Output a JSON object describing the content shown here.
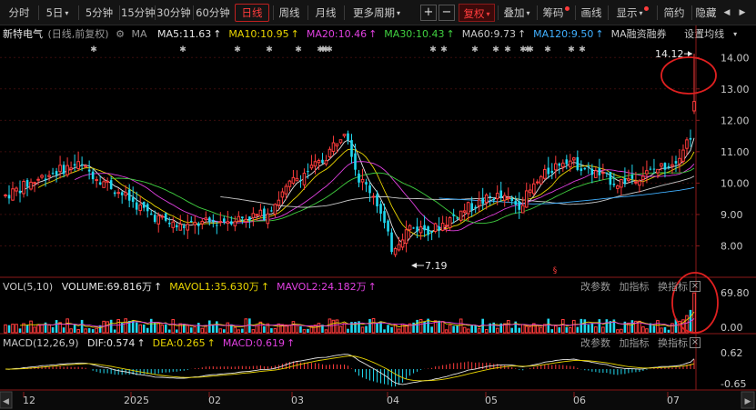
{
  "toolbar": {
    "periods": [
      "分时",
      "5日",
      "5分钟",
      "15分钟",
      "30分钟",
      "60分钟",
      "日线",
      "周线",
      "月线",
      "更多周期"
    ],
    "active_period": "日线",
    "plus": "+",
    "minus": "−",
    "fuquan": "复权",
    "diejia": "叠加",
    "chouma": "筹码",
    "huaxian": "画线",
    "xianshi": "显示",
    "jianyue": "简约",
    "yincang": "隐藏"
  },
  "stock": {
    "name": "新特电气",
    "mode": "(日线,前复权)"
  },
  "ma": {
    "label": "MA",
    "items": [
      {
        "text": "MA5:11.63",
        "color": "#e6e6e6"
      },
      {
        "text": "MA10:10.95",
        "color": "#e8d400"
      },
      {
        "text": "MA20:10.46",
        "color": "#e040e0"
      },
      {
        "text": "MA30:10.43",
        "color": "#40d040"
      },
      {
        "text": "MA60:9.73",
        "color": "#c8c8c8"
      },
      {
        "text": "MA120:9.50",
        "color": "#40b0ff"
      },
      {
        "text": "MA融资融券",
        "color": "#c8c8c8"
      }
    ],
    "settings": "设置均线"
  },
  "price_axis": [
    "14.00",
    "13.00",
    "12.00",
    "11.00",
    "10.00",
    "9.00",
    "8.00"
  ],
  "annotations": {
    "high": "14.12",
    "low": "7.19"
  },
  "volume": {
    "header": "VOL(5,10)",
    "items": [
      {
        "text": "VOLUME:69.816万",
        "color": "#e6e6e6"
      },
      {
        "text": "MAVOL1:35.630万",
        "color": "#e8d400"
      },
      {
        "text": "MAVOL2:24.182万",
        "color": "#e040e0"
      }
    ],
    "axis": [
      "69.80",
      "0.00"
    ]
  },
  "macd": {
    "header": "MACD(12,26,9)",
    "items": [
      {
        "text": "DIF:0.574",
        "color": "#e6e6e6"
      },
      {
        "text": "DEA:0.265",
        "color": "#e8d400"
      },
      {
        "text": "MACD:0.619",
        "color": "#e040e0"
      }
    ],
    "axis": [
      "0.62",
      "-0.65"
    ]
  },
  "panel_buttons": {
    "gaicanshu": "改参数",
    "jiazhibiao": "加指标",
    "huanzhibiao": "换指标"
  },
  "date_axis": [
    "12",
    "2025",
    "02",
    "03",
    "04",
    "05",
    "06",
    "07"
  ],
  "colors": {
    "up": "#ff3c3c",
    "down": "#20d8f0",
    "highlight": "#e02020"
  }
}
